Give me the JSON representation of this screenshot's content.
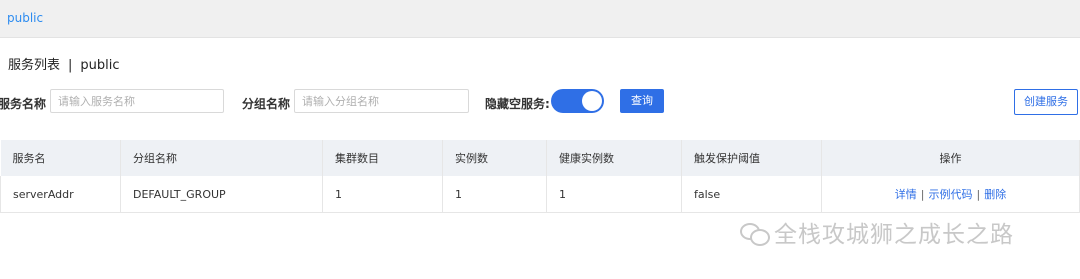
{
  "header": {
    "namespace": "public"
  },
  "page": {
    "title": "服务列表",
    "separator": "|",
    "namespace": "public"
  },
  "filters": {
    "service_name_label": "服务名称",
    "service_name_placeholder": "请输入服务名称",
    "group_name_label": "分组名称",
    "group_name_placeholder": "请输入分组名称",
    "hide_empty_label": "隐藏空服务:",
    "hide_empty_on": true,
    "query_button": "查询",
    "create_button": "创建服务"
  },
  "table": {
    "headers": [
      "服务名",
      "分组名称",
      "集群数目",
      "实例数",
      "健康实例数",
      "触发保护阈值",
      "操作"
    ],
    "rows": [
      {
        "service": "serverAddr",
        "group": "DEFAULT_GROUP",
        "clusters": "1",
        "instances": "1",
        "healthy": "1",
        "threshold": "false",
        "actions": [
          "详情",
          "示例代码",
          "删除"
        ]
      }
    ],
    "action_separator": "|"
  },
  "watermark": {
    "text": "全栈攻城狮之成长之路"
  },
  "colors": {
    "accent": "#2f6fe6",
    "link": "#2d8cf0",
    "header_bg": "#f0f0f0",
    "table_head_bg": "#eef1f5"
  }
}
